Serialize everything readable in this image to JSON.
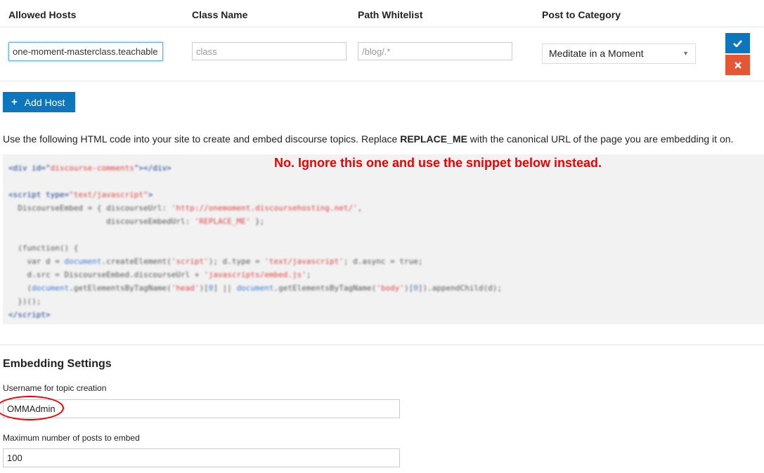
{
  "table": {
    "headers": [
      "Allowed Hosts",
      "Class Name",
      "Path Whitelist",
      "Post to Category"
    ],
    "row": {
      "host_value": "one-moment-masterclass.teachable.",
      "class_placeholder": "class",
      "path_placeholder": "/blog/.*",
      "category_value": "Meditate in a Moment",
      "save_icon": "check-icon",
      "cancel_icon": "times-icon"
    }
  },
  "add_host_label": "Add Host",
  "description": {
    "prefix": "Use the following HTML code into your site to create and embed discourse topics. Replace ",
    "bold": "REPLACE_ME",
    "suffix": " with the canonical URL of the page you are embedding it on."
  },
  "annotation": "No. Ignore this one and use the snippet below instead.",
  "embedding": {
    "title": "Embedding Settings",
    "username_label": "Username for topic creation",
    "username_value": "OMMAdmin",
    "max_posts_label": "Maximum number of posts to embed",
    "max_posts_value": "100"
  },
  "colors": {
    "primary": "#0e76bd",
    "danger": "#e45735",
    "annotation": "#ee0000"
  }
}
